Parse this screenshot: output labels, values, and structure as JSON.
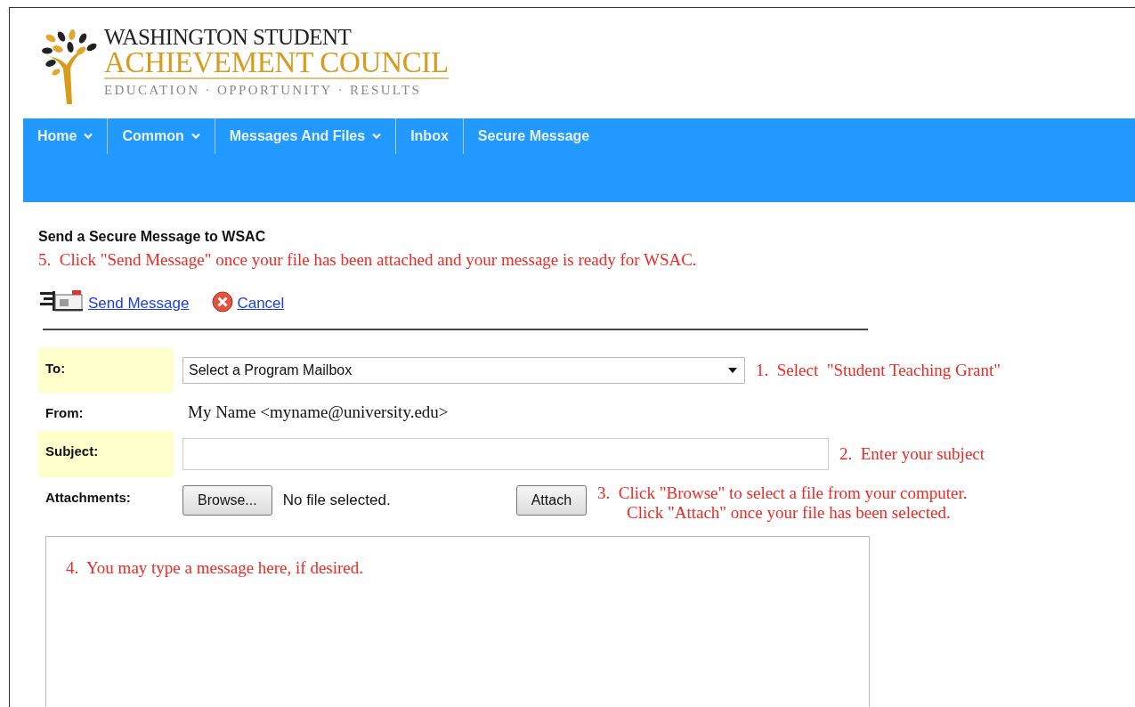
{
  "logo": {
    "line1": "WASHINGTON STUDENT",
    "line2": "ACHIEVEMENT COUNCIL",
    "tagline": "EDUCATION · OPPORTUNITY · RESULTS"
  },
  "nav": [
    {
      "label": "Home",
      "dropdown": true
    },
    {
      "label": "Common",
      "dropdown": true
    },
    {
      "label": "Messages And Files",
      "dropdown": true
    },
    {
      "label": "Inbox",
      "dropdown": false
    },
    {
      "label": "Secure Message",
      "dropdown": false
    }
  ],
  "heading": "Send a Secure Message to WSAC",
  "step_note": "5.  Click \"Send Message\" once your file has been attached and your message is ready for WSAC.",
  "actions": [
    {
      "kind": "send",
      "label": "Send Message"
    },
    {
      "kind": "cancel",
      "label": "Cancel"
    }
  ],
  "rows": [
    {
      "kind": "select",
      "label": "To:",
      "highlighted": true,
      "value": "Select a Program Mailbox",
      "notes": [
        "1.  Select  \"Student Teaching Grant\""
      ]
    },
    {
      "kind": "text",
      "label": "From:",
      "highlighted": false,
      "value": "My Name <myname@university.edu>"
    },
    {
      "kind": "input",
      "label": "Subject:",
      "highlighted": true,
      "notes": [
        "2.  Enter your subject"
      ]
    },
    {
      "kind": "file",
      "label": "Attachments:",
      "highlighted": false,
      "browse": "Browse...",
      "file_status": "No file selected.",
      "attach": "Attach",
      "notes": [
        "3.  Click \"Browse\" to select a file from your computer.",
        "Click \"Attach\" once your file has been selected."
      ]
    }
  ],
  "message_note": "4.  You may type a message here, if desired."
}
